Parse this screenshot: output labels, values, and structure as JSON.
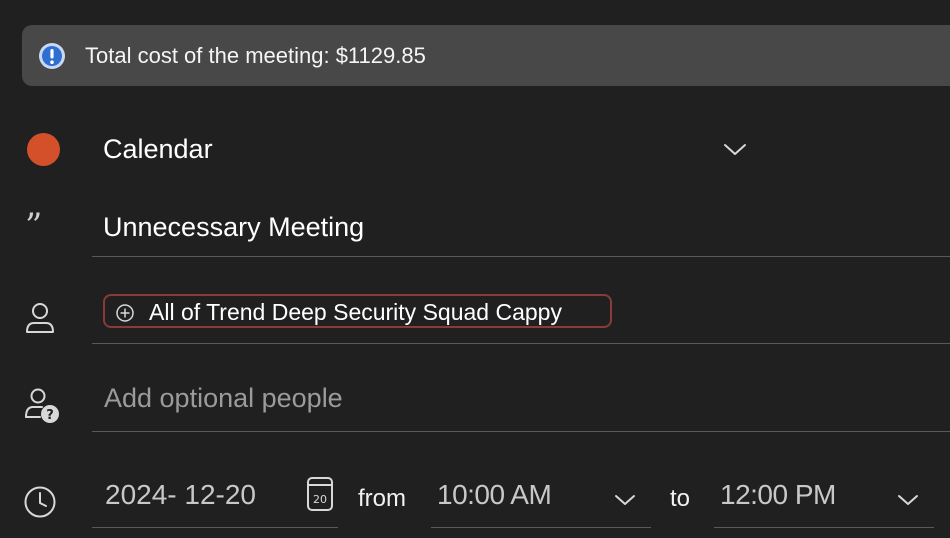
{
  "banner": {
    "text": "Total cost of the meeting: $1129.85",
    "icon": "info-icon"
  },
  "calendar": {
    "label": "Calendar",
    "color": "#d4502b"
  },
  "meeting": {
    "title": "Unnecessary Meeting"
  },
  "attendees": {
    "required": [
      {
        "label": "All of Trend Deep Security Squad Cappy"
      }
    ]
  },
  "optional_people": {
    "value": "",
    "placeholder": "Add optional people"
  },
  "schedule": {
    "date": "2024- 12-20",
    "calendar_day": "20",
    "from_label": "from",
    "start_time": "10:00 AM",
    "to_label": "to",
    "end_time": "12:00 PM"
  },
  "colors": {
    "background": "#202020",
    "banner_background": "#484848",
    "chip_border": "#8a3a3a",
    "divider": "#5a5a5a"
  }
}
